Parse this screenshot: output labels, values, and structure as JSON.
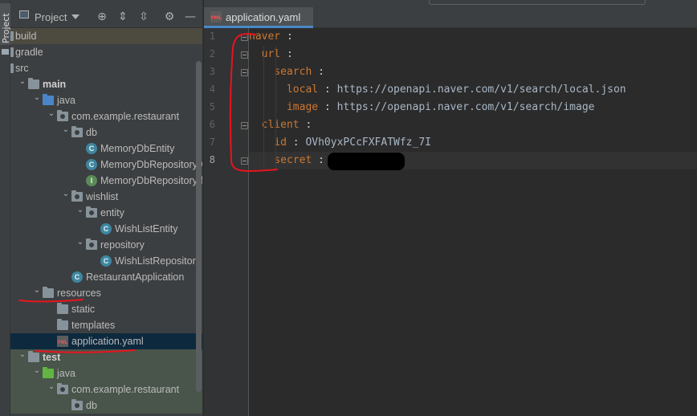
{
  "tool_strip": {
    "project_tab": "Project"
  },
  "panel": {
    "title": "Project",
    "icons": [
      "crosshair-icon",
      "expand-all-icon",
      "collapse-all-icon",
      "gear-icon",
      "minimize-icon"
    ]
  },
  "tree": [
    {
      "label": "build",
      "depth": 0,
      "icon": "folder",
      "arrow": ""
    },
    {
      "label": "gradle",
      "depth": 0,
      "icon": "folder",
      "arrow": ""
    },
    {
      "label": "src",
      "depth": 0,
      "icon": "folder",
      "arrow": ""
    },
    {
      "label": "main",
      "depth": 1,
      "icon": "folder",
      "arrow": "down"
    },
    {
      "label": "java",
      "depth": 2,
      "icon": "folder-blue",
      "arrow": "down"
    },
    {
      "label": "com.example.restaurant",
      "depth": 3,
      "icon": "package",
      "arrow": "down"
    },
    {
      "label": "db",
      "depth": 4,
      "icon": "package",
      "arrow": "down"
    },
    {
      "label": "MemoryDbEntity",
      "depth": 5,
      "icon": "class",
      "arrow": ""
    },
    {
      "label": "MemoryDbRepositoryAbstr",
      "depth": 5,
      "icon": "abstract-class",
      "arrow": ""
    },
    {
      "label": "MemoryDbRepositoryIfs",
      "depth": 5,
      "icon": "interface",
      "arrow": ""
    },
    {
      "label": "wishlist",
      "depth": 4,
      "icon": "package",
      "arrow": "down"
    },
    {
      "label": "entity",
      "depth": 5,
      "icon": "package",
      "arrow": "down"
    },
    {
      "label": "WishListEntity",
      "depth": 6,
      "icon": "class",
      "arrow": ""
    },
    {
      "label": "repository",
      "depth": 5,
      "icon": "package",
      "arrow": "down"
    },
    {
      "label": "WishListRepository",
      "depth": 6,
      "icon": "class",
      "arrow": ""
    },
    {
      "label": "RestaurantApplication",
      "depth": 4,
      "icon": "class",
      "arrow": ""
    },
    {
      "label": "resources",
      "depth": 2,
      "icon": "folder-res",
      "arrow": "down"
    },
    {
      "label": "static",
      "depth": 3,
      "icon": "folder",
      "arrow": ""
    },
    {
      "label": "templates",
      "depth": 3,
      "icon": "folder",
      "arrow": ""
    },
    {
      "label": "application.yaml",
      "depth": 3,
      "icon": "yaml",
      "arrow": ""
    },
    {
      "label": "test",
      "depth": 1,
      "icon": "folder",
      "arrow": "down"
    },
    {
      "label": "java",
      "depth": 2,
      "icon": "folder-green",
      "arrow": "down"
    },
    {
      "label": "com.example.restaurant",
      "depth": 3,
      "icon": "package",
      "arrow": "down"
    },
    {
      "label": "db",
      "depth": 4,
      "icon": "package",
      "arrow": ""
    }
  ],
  "editor": {
    "tab_label": "application.yaml",
    "lines": [
      {
        "num": "1",
        "indent": 0,
        "key": "naver",
        "sep": " :",
        "value": ""
      },
      {
        "num": "2",
        "indent": 1,
        "key": "url",
        "sep": " :",
        "value": ""
      },
      {
        "num": "3",
        "indent": 2,
        "key": "search",
        "sep": " :",
        "value": ""
      },
      {
        "num": "4",
        "indent": 3,
        "key": "local",
        "sep": " : ",
        "value": "https://openapi.naver.com/v1/search/local.json"
      },
      {
        "num": "5",
        "indent": 3,
        "key": "image",
        "sep": " : ",
        "value": "https://openapi.naver.com/v1/search/image"
      },
      {
        "num": "6",
        "indent": 1,
        "key": "client",
        "sep": " :",
        "value": ""
      },
      {
        "num": "7",
        "indent": 2,
        "key": "id",
        "sep": " : ",
        "value": "OVh0yxPCcFXFATWfz_7I"
      },
      {
        "num": "8",
        "indent": 2,
        "key": "secret",
        "sep": " :",
        "value": ""
      }
    ]
  },
  "colors": {
    "yaml_key": "#cc7832",
    "yaml_value": "#a9b7c6",
    "annotation_red": "#e8141e"
  }
}
